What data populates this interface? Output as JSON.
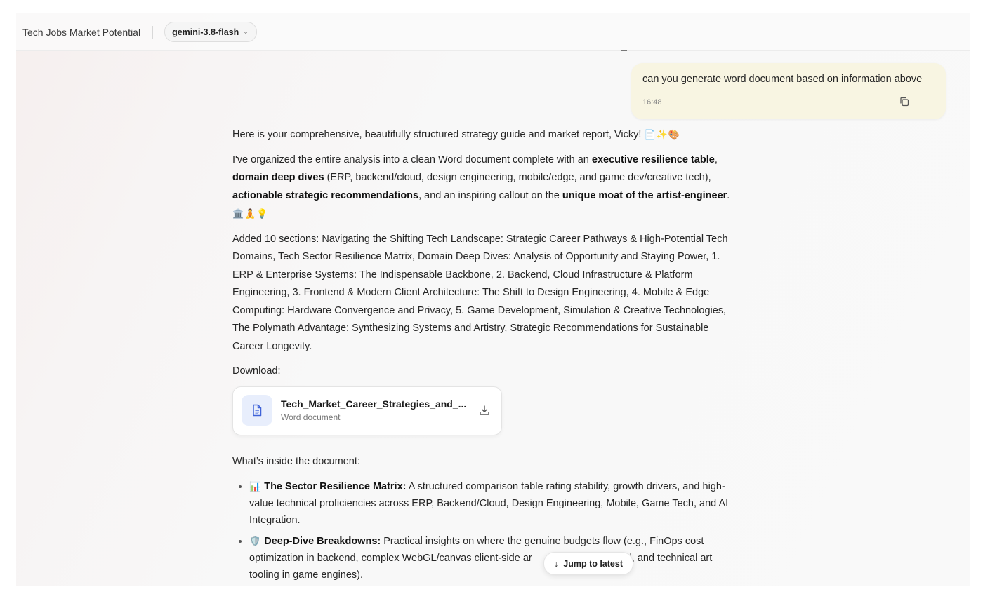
{
  "header": {
    "title": "Tech Jobs Market Potential",
    "model": "gemini-3.8-flash"
  },
  "user_message": {
    "text": "can you generate word document based on information above",
    "time": "16:48"
  },
  "response": {
    "intro": "Here is your comprehensive, beautifully structured strategy guide and market report, Vicky!",
    "intro_emoji": "📄✨🎨",
    "para2": {
      "t1": "I've organized the entire analysis into a clean Word document complete with an ",
      "b1": "executive resilience table",
      "t2": ", ",
      "b2": "domain deep dives",
      "t3": " (ERP, backend/cloud, design engineering, mobile/edge, and game dev/creative tech), ",
      "b3": "actionable strategic recommendations",
      "t4": ", and an inspiring callout on the ",
      "b4": "unique moat of the artist-engineer",
      "t5": ".",
      "emoji": "🏛️🧘💡"
    },
    "sections": "Added 10 sections: Navigating the Shifting Tech Landscape: Strategic Career Pathways & High-Potential Tech Domains, Tech Sector Resilience Matrix, Domain Deep Dives: Analysis of Opportunity and Staying Power, 1. ERP & Enterprise Systems: The Indispensable Backbone, 2. Backend, Cloud Infrastructure & Platform Engineering, 3. Frontend & Modern Client Architecture: The Shift to Design Engineering, 4. Mobile & Edge Computing: Hardware Convergence and Privacy, 5. Game Development, Simulation & Creative Technologies, The Polymath Advantage: Synthesizing Systems and Artistry, Strategic Recommendations for Sustainable Career Longevity.",
    "download_label": "Download:",
    "file": {
      "name": "Tech_Market_Career_Strategies_and_...",
      "type": "Word document"
    },
    "inside_title": "What’s inside the document:",
    "bullets": [
      {
        "emoji": "📊",
        "title": "The Sector Resilience Matrix:",
        "text": " A structured comparison table rating stability, growth drivers, and high-value technical proficiencies across ERP, Backend/Cloud, Design Engineering, Mobile, Game Tech, and AI Integration."
      },
      {
        "emoji": "🛡️",
        "title": "Deep-Dive Breakdowns:",
        "text": " Practical insights on where the genuine budgets flow (e.g., FinOps cost optimization in backend, complex WebGL/canvas client-side ar",
        "text_after": "d, and technical art tooling in game engines)."
      }
    ]
  },
  "jump_button": {
    "label": "Jump to latest",
    "arrow": "↓"
  }
}
